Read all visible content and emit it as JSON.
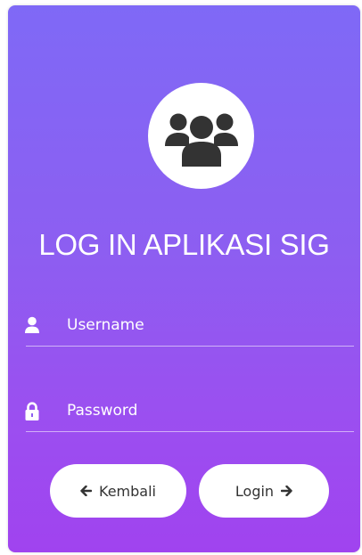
{
  "login": {
    "title": "LOG IN APLIKASI SIG",
    "username_label": "Username",
    "password_label": "Password",
    "back_label": "Kembali",
    "login_label": "Login"
  }
}
